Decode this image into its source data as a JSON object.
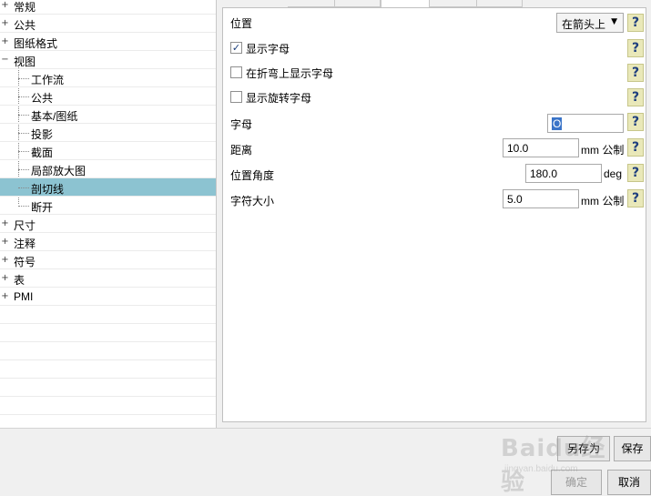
{
  "tree": {
    "items": [
      {
        "label": "常规",
        "expander": "+"
      },
      {
        "label": "公共",
        "expander": "+"
      },
      {
        "label": "图纸格式",
        "expander": "+"
      },
      {
        "label": "视图",
        "expander": "−"
      },
      {
        "label": "工作流",
        "expander": ""
      },
      {
        "label": "公共",
        "expander": ""
      },
      {
        "label": "基本/图纸",
        "expander": ""
      },
      {
        "label": "投影",
        "expander": ""
      },
      {
        "label": "截面",
        "expander": ""
      },
      {
        "label": "局部放大图",
        "expander": ""
      },
      {
        "label": "剖切线",
        "expander": "",
        "selected": true
      },
      {
        "label": "断开",
        "expander": ""
      },
      {
        "label": "尺寸",
        "expander": "+"
      },
      {
        "label": "注释",
        "expander": "+"
      },
      {
        "label": "符号",
        "expander": "+"
      },
      {
        "label": "表",
        "expander": "+"
      },
      {
        "label": "PMI",
        "expander": "+"
      }
    ]
  },
  "settings": {
    "position_label": "位置",
    "position_value": "在箭头上",
    "show_letter_label": "显示字母",
    "show_letter_checked": true,
    "show_on_bend_label": "在折弯上显示字母",
    "show_on_bend_checked": false,
    "show_rotate_label": "显示旋转字母",
    "show_rotate_checked": false,
    "letter_label": "字母",
    "letter_value": "O",
    "distance_label": "距离",
    "distance_value": "10.0",
    "distance_unit": "mm 公制",
    "angle_label": "位置角度",
    "angle_value": "180.0",
    "angle_unit": "deg",
    "char_size_label": "字符大小",
    "char_size_value": "5.0",
    "char_size_unit": "mm 公制",
    "help_glyph": "?",
    "help_icon": "help-question-icon"
  },
  "buttons": {
    "save_as": "另存为",
    "save": "保存",
    "ok": "确定",
    "cancel": "取消"
  },
  "watermark": {
    "logo_text": "Baidu经验",
    "url": "jingyan.baidu.com"
  },
  "colors": {
    "selection": "#8cc3d1",
    "help_bg": "#e9e8b9",
    "text_highlight": "#3a74c8"
  }
}
